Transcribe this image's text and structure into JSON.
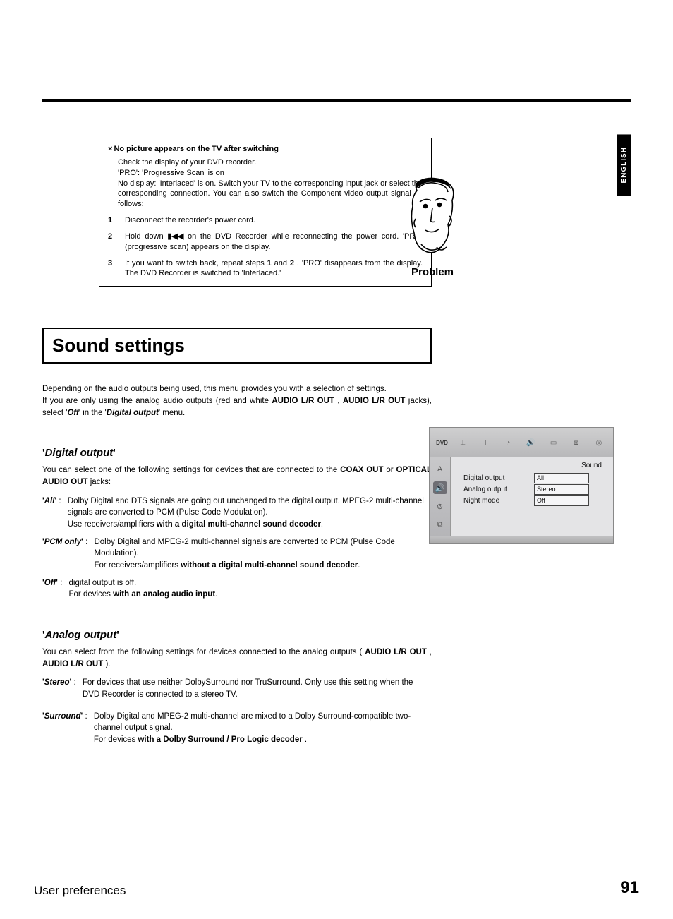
{
  "lang_tab": "ENGLISH",
  "problem_box": {
    "bullet_mark": "×",
    "title": "No picture appears on the TV after switching",
    "body_lines": [
      "Check the display of your DVD recorder.",
      "'PRO': 'Progressive Scan' is on",
      "No display: 'Interlaced' is on. Switch your TV to the corresponding input jack or select the corresponding connection. You can also switch the Component video output signal as follows:"
    ],
    "steps": [
      {
        "num": "1",
        "text": "Disconnect the recorder's power cord."
      },
      {
        "num": "2",
        "pre": "Hold down ",
        "glyph": "▮◀◀",
        "post": " on the DVD Recorder while reconnecting the power cord. 'PRO' (progressive scan) appears on the display."
      },
      {
        "num": "3",
        "pre": "If you want to switch back, repeat steps ",
        "b1": "1",
        "mid": " and ",
        "b2": "2",
        "post": " . 'PRO' disappears from the display. The DVD Recorder is switched to 'Interlaced.'"
      }
    ],
    "face_label": "Problem"
  },
  "section_title": "Sound settings",
  "intro": {
    "line1": "Depending on the audio outputs being used, this menu provides you with a selection of settings.",
    "line2_pre": "If you are only using the analog audio outputs (red and white ",
    "b1": "AUDIO L/R OUT",
    "comma": " , ",
    "b2": "AUDIO L/R OUT",
    "mid1": " jacks), select '",
    "off_b": "Off",
    "mid2": "' in the '",
    "digital_b": "Digital output",
    "end": "' menu."
  },
  "digital_output": {
    "heading_term": "Digital output",
    "para_pre": "You can select one of the following settings for devices that are connected to the ",
    "b1": "COAX OUT",
    "mid": " or ",
    "b2": "OPTICAL AUDIO OUT",
    "end": " jacks:",
    "items": [
      {
        "key": "All",
        "line1": "Dolby Digital and DTS signals are going out unchanged to the digital output. MPEG-2 multi-channel signals are converted to PCM (Pulse Code Modulation).",
        "note_pre": "Use receivers/amplifiers ",
        "note_b": "with a digital multi-channel sound decoder",
        "note_post": "."
      },
      {
        "key": "PCM only",
        "line1": "Dolby Digital and MPEG-2 multi-channel signals are converted to PCM (Pulse Code Modulation).",
        "note_pre": "For receivers/amplifiers ",
        "note_b": "without a digital multi-channel sound decoder",
        "note_post": "."
      },
      {
        "key": "Off",
        "line1": "digital output is off.",
        "note_pre": "For devices ",
        "note_b": "with an analog audio input",
        "note_post": "."
      }
    ]
  },
  "analog_output": {
    "heading_term": "Analog output",
    "para_pre": "You can select from the following settings for devices connected to the analog outputs ( ",
    "b1": "AUDIO L/R OUT",
    "comma": " , ",
    "b2": "AUDIO L/R OUT",
    "end": " ).",
    "items": [
      {
        "key": "Stereo",
        "line1": "For devices that use neither DolbySurround nor TruSurround. Only use this setting when the DVD Recorder is connected to a stereo TV."
      },
      {
        "key": "Surround",
        "line1": "Dolby Digital and MPEG-2 multi-channel are mixed to a Dolby Surround-compatible two-channel output signal.",
        "note_pre": "For devices ",
        "note_b": "with a Dolby Surround / Pro Logic decoder",
        "note_post": " ."
      }
    ]
  },
  "menu": {
    "dvd_label": "DVD",
    "title": "Sound",
    "rows": [
      {
        "label": "Digital output",
        "value": "All"
      },
      {
        "label": "Analog output",
        "value": "Stereo"
      },
      {
        "label": "Night mode",
        "value": "Off"
      }
    ]
  },
  "footer": {
    "left": "User preferences",
    "right": "91"
  }
}
